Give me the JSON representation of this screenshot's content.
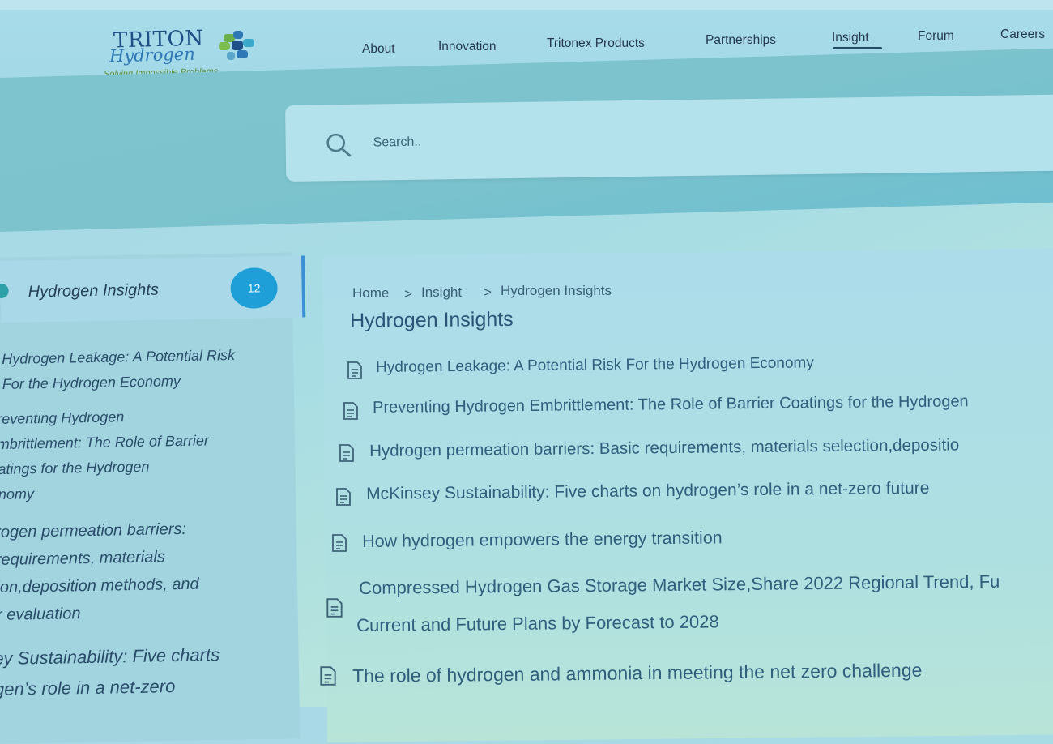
{
  "brand": {
    "name_line1": "TRITON",
    "name_line2": "Hydrogen",
    "tagline": "Solving Impossible Problems",
    "colors": {
      "navy": "#1e4f86",
      "blue": "#2d78b5",
      "green": "#5b8f3f",
      "teal": "#3aa9c9"
    }
  },
  "nav": {
    "items": [
      {
        "label": "About",
        "active": false
      },
      {
        "label": "Innovation",
        "active": false
      },
      {
        "label": "Tritonex Products",
        "active": false
      },
      {
        "label": "Partnerships",
        "active": false
      },
      {
        "label": "Insight",
        "active": true
      },
      {
        "label": "Forum",
        "active": false
      },
      {
        "label": "Careers",
        "active": false
      }
    ]
  },
  "search": {
    "placeholder": "Search..",
    "icon": "search-icon"
  },
  "sidebar": {
    "heading": "Hydrogen Insights",
    "count": "12",
    "accent": "#3b8fd4",
    "items": [
      "Hydrogen Leakage: A Potential Risk\nFor the Hydrogen Economy",
      "reventing Hydrogen\nmbrittlement: The Role of Barrier\natings for the Hydrogen\nnomy",
      "rogen permeation barriers:\n requirements, materials\nion,deposition methods, and\nr evaluation",
      "ey Sustainability: Five charts\ngen’s role in a net-zero"
    ]
  },
  "breadcrumb": {
    "items": [
      "Home",
      "Insight",
      "Hydrogen Insights"
    ],
    "separator": ">"
  },
  "main": {
    "title": "Hydrogen Insights",
    "articles": [
      {
        "line1": "Hydrogen Leakage: A Potential Risk For the Hydrogen Economy",
        "line2": ""
      },
      {
        "line1": "Preventing Hydrogen Embrittlement: The Role of Barrier Coatings for the Hydrogen",
        "line2": ""
      },
      {
        "line1": "Hydrogen permeation barriers: Basic requirements, materials selection,depositio",
        "line2": ""
      },
      {
        "line1": "McKinsey Sustainability: Five charts on hydrogen’s role in a net-zero future",
        "line2": ""
      },
      {
        "line1": "How hydrogen empowers the energy transition",
        "line2": ""
      },
      {
        "line1": "Compressed Hydrogen Gas Storage Market Size,Share 2022 Regional Trend, Fu",
        "line2": "Current and Future Plans by Forecast to 2028"
      },
      {
        "line1": "The role of hydrogen and ammonia in meeting the net zero challenge",
        "line2": ""
      }
    ],
    "icon": "document-icon"
  }
}
